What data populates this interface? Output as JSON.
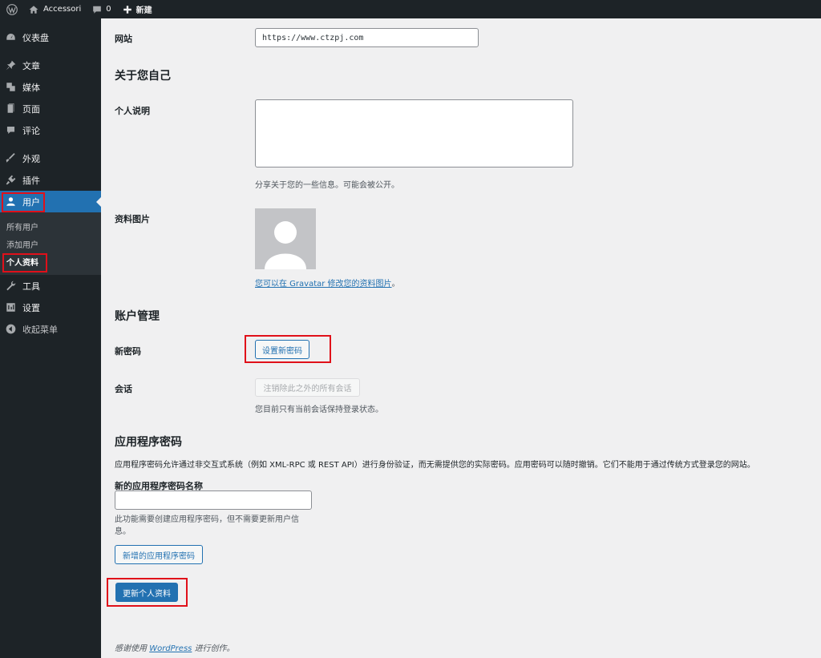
{
  "adminbar": {
    "site_name": "Accessori",
    "comments_count": "0",
    "new_label": "新建"
  },
  "sidebar": {
    "items": [
      {
        "label": "仪表盘",
        "icon": "dashboard-icon"
      },
      {
        "label": "文章",
        "icon": "pin-icon"
      },
      {
        "label": "媒体",
        "icon": "media-icon"
      },
      {
        "label": "页面",
        "icon": "page-icon"
      },
      {
        "label": "评论",
        "icon": "comment-icon"
      },
      {
        "label": "外观",
        "icon": "brush-icon"
      },
      {
        "label": "插件",
        "icon": "plugin-icon"
      },
      {
        "label": "用户",
        "icon": "user-icon"
      },
      {
        "label": "工具",
        "icon": "wrench-icon"
      },
      {
        "label": "设置",
        "icon": "settings-icon"
      },
      {
        "label": "收起菜单",
        "icon": "collapse-icon"
      }
    ],
    "submenu": [
      "所有用户",
      "添加用户",
      "个人资料"
    ]
  },
  "form": {
    "website_label": "网站",
    "website_value": "https://www.ctzpj.com",
    "about_heading": "关于您自己",
    "bio_label": "个人说明",
    "bio_value": "",
    "bio_desc": "分享关于您的一些信息。可能会被公开。",
    "picture_label": "资料图片",
    "gravatar_link": "您可以在 Gravatar 修改您的资料图片",
    "gravatar_period": "。",
    "account_heading": "账户管理",
    "new_password_label": "新密码",
    "set_password_button": "设置新密码",
    "sessions_label": "会话",
    "logout_others_button": "注销除此之外的所有会话",
    "sessions_desc": "您目前只有当前会话保持登录状态。",
    "app_pw_heading": "应用程序密码",
    "app_pw_desc": "应用程序密码允许通过非交互式系统（例如 XML-RPC 或 REST API）进行身份验证，而无需提供您的实际密码。应用密码可以随时撤销。它们不能用于通过传统方式登录您的网站。",
    "app_pw_name_label": "新的应用程序密码名称",
    "app_pw_name_value": "",
    "app_pw_name_desc": "此功能需要创建应用程序密码，但不需要更新用户信息。",
    "add_app_pw_button": "新增的应用程序密码",
    "update_profile_button": "更新个人资料"
  },
  "footer": {
    "thanks_prefix": "感谢使用",
    "wordpress_link": "WordPress",
    "thanks_suffix": "进行创作。"
  },
  "colors": {
    "accent": "#2271b1",
    "sidebar_bg": "#1d2327",
    "highlight_box": "#e0101a"
  }
}
